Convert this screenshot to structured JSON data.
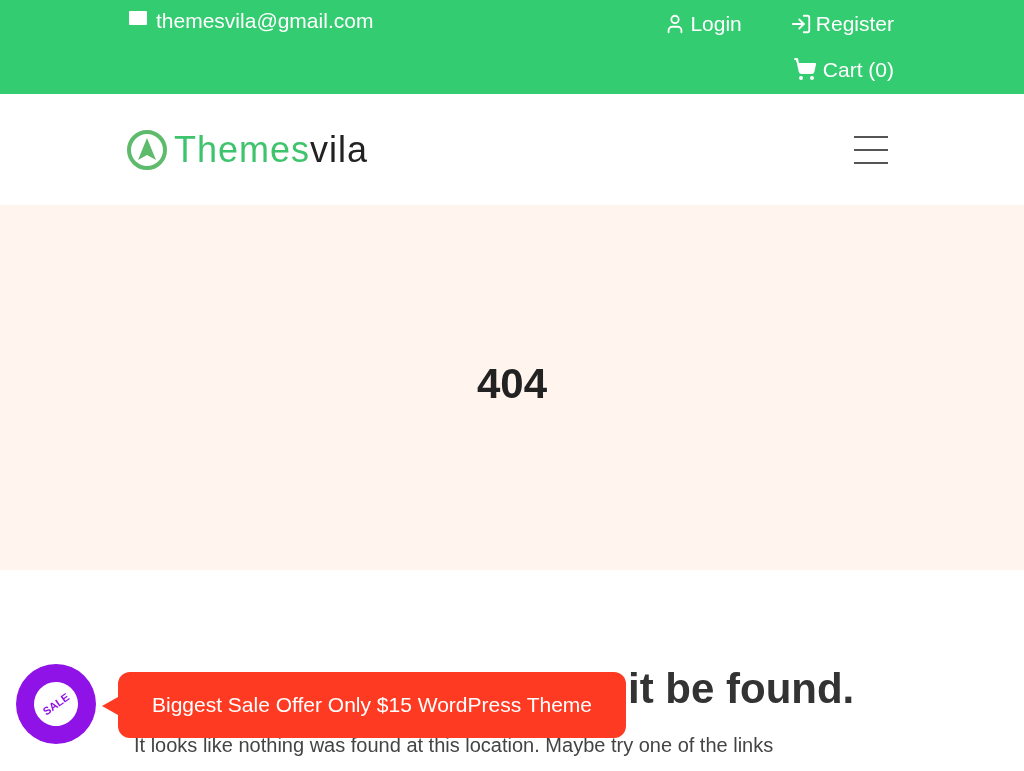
{
  "top_bar": {
    "email": "themesvila@gmail.com",
    "links": [
      {
        "label": "Login",
        "kind": "login"
      },
      {
        "label": "Register",
        "kind": "register"
      }
    ],
    "cart": "Cart (0)"
  },
  "header": {
    "logo_main": "Themes",
    "logo_accent": "vila"
  },
  "hero": {
    "title": "404"
  },
  "content": {
    "heading": "it be found.",
    "text": "It looks like nothing was found at this location. Maybe try one of the links"
  },
  "sale_popup": {
    "badge": "SALE",
    "message": "Biggest Sale Offer Only $15 WordPress Theme"
  }
}
